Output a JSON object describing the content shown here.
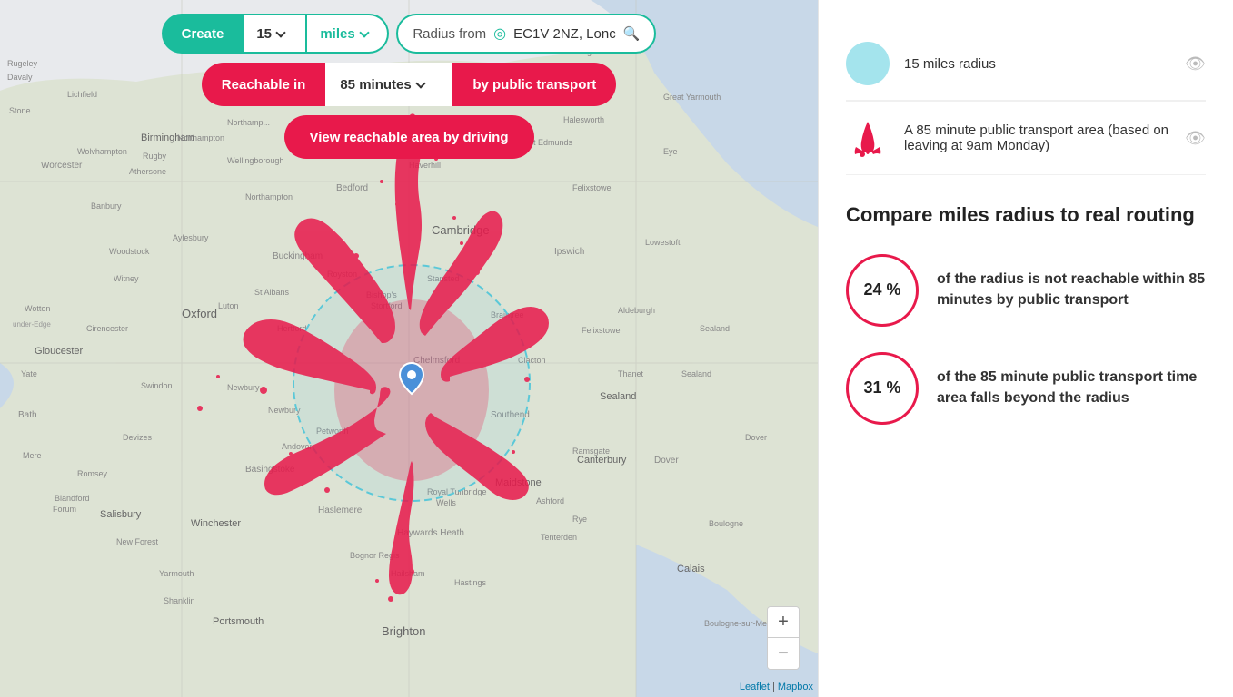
{
  "controls": {
    "create_label": "Create",
    "number_value": "15",
    "miles_label": "miles",
    "radius_from_label": "Radius from",
    "location_value": "EC1V 2NZ, Lonc",
    "reachable_label": "Reachable in",
    "minutes_value": "85 minutes",
    "by_transport_label": "by public transport",
    "view_driving_label": "View reachable area by driving"
  },
  "legend": {
    "item1": {
      "label": "15 miles radius",
      "color": "teal"
    },
    "item2": {
      "label": "A 85 minute public transport area (based on leaving at 9am Monday)"
    }
  },
  "compare": {
    "title": "Compare miles radius to real routing",
    "stat1": {
      "percent": "24 %",
      "description": "of the radius is not reachable within 85 minutes by public transport"
    },
    "stat2": {
      "percent": "31 %",
      "description": "of the 85 minute public transport time area falls beyond the radius"
    }
  },
  "attribution": {
    "leaflet": "Leaflet",
    "mapbox": "Mapbox"
  },
  "icons": {
    "location": "⊙",
    "search": "🔍",
    "eye": "👁",
    "zoom_in": "+",
    "zoom_out": "−"
  }
}
